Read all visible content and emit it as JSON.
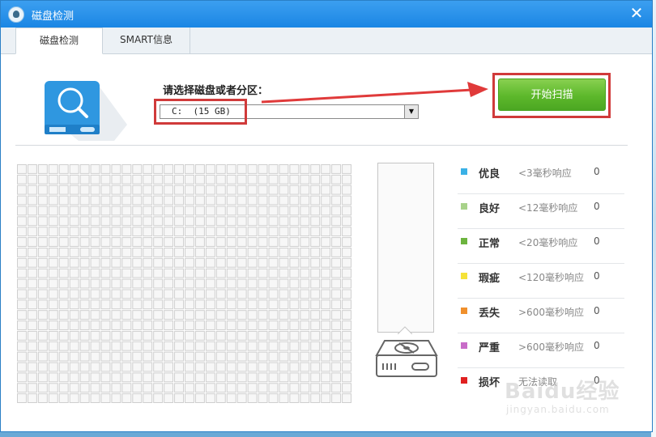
{
  "window": {
    "title": "磁盘检测",
    "close_glyph": "✕"
  },
  "tabs": [
    {
      "label": "磁盘检测",
      "active": true
    },
    {
      "label": "SMART信息",
      "active": false
    }
  ],
  "selector": {
    "label": "请选择磁盘或者分区：",
    "value": "C:  (15 GB)",
    "arrow_glyph": "▼"
  },
  "scan_button": {
    "label": "开始扫描"
  },
  "sector_grid": {
    "columns": 32,
    "rows": 23,
    "scanned_fraction": 0
  },
  "legend": [
    {
      "name": "优良",
      "desc": "<3毫秒响应",
      "count": "0",
      "color": "#3ab1e6"
    },
    {
      "name": "良好",
      "desc": "<12毫秒响应",
      "count": "0",
      "color": "#a8d28a"
    },
    {
      "name": "正常",
      "desc": "<20毫秒响应",
      "count": "0",
      "color": "#6db43e"
    },
    {
      "name": "瑕疵",
      "desc": "<120毫秒响应",
      "count": "0",
      "color": "#f5e238"
    },
    {
      "name": "丢失",
      "desc": ">600毫秒响应",
      "count": "0",
      "color": "#f0902c"
    },
    {
      "name": "严重",
      "desc": ">600毫秒响应",
      "count": "0",
      "color": "#c86cc8"
    },
    {
      "name": "损坏",
      "desc": "无法读取",
      "count": "0",
      "color": "#e02020"
    }
  ],
  "colors": {
    "titlebar": "#1a86e4",
    "accent_red": "#d03a3a",
    "scan_green": "#5db82b",
    "disk_blue": "#2f97e0"
  },
  "watermark": {
    "logo": "Baidu经验",
    "url": "jingyan.baidu.com"
  },
  "icons": {
    "app": "app-logo-icon",
    "close": "close-icon",
    "disk": "disk-search-icon",
    "hdd": "hard-drive-icon"
  }
}
